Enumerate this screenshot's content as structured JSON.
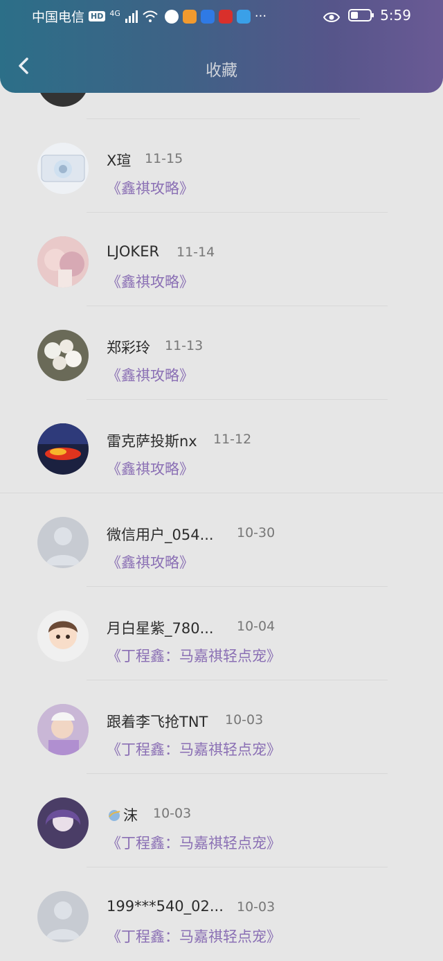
{
  "status_bar": {
    "carrier": "中国电信",
    "hd": "HD",
    "network": "4G",
    "time": "5:59",
    "more": "···"
  },
  "header": {
    "title": "收藏"
  },
  "items": [
    {
      "name": "X瑄",
      "date": "11-15",
      "work": "《鑫祺攻略》"
    },
    {
      "name": "LJOKER",
      "date": "11-14",
      "work": "《鑫祺攻略》"
    },
    {
      "name": "郑彩玲",
      "date": "11-13",
      "work": "《鑫祺攻略》"
    },
    {
      "name": "雷克萨投斯nx",
      "date": "11-12",
      "work": "《鑫祺攻略》"
    },
    {
      "name": "微信用户_054...",
      "date": "10-30",
      "work": "《鑫祺攻略》"
    },
    {
      "name": "月白星紫_780...",
      "date": "10-04",
      "work": "《丁程鑫：马嘉祺轻点宠》"
    },
    {
      "name": "跟着李飞抢TNT",
      "date": "10-03",
      "work": "《丁程鑫：马嘉祺轻点宠》"
    },
    {
      "name": "沫",
      "date": "10-03",
      "work": "《丁程鑫：马嘉祺轻点宠》"
    },
    {
      "name": "199***540_02...",
      "date": "10-03",
      "work": "《丁程鑫：马嘉祺轻点宠》"
    }
  ],
  "colors": {
    "accent_text": "#8a6fb4",
    "header_start": "#2c6f88",
    "header_end": "#6a5a95"
  }
}
